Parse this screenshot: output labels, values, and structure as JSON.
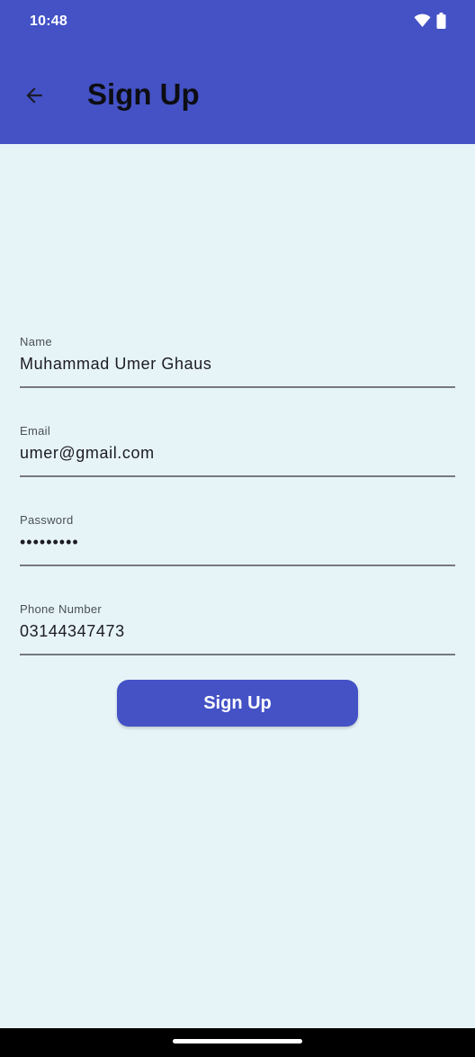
{
  "status_bar": {
    "time": "10:48",
    "icons": [
      "wifi-icon",
      "battery-icon"
    ]
  },
  "app_bar": {
    "title": "Sign Up",
    "back_icon": "arrow-back-icon"
  },
  "form": {
    "fields": [
      {
        "label": "Name",
        "value": "Muhammad Umer Ghaus"
      },
      {
        "label": "Email",
        "value": "umer@gmail.com"
      },
      {
        "label": "Password",
        "value": "•••••••••"
      },
      {
        "label": "Phone Number",
        "value": "03144347473"
      }
    ],
    "submit_label": "Sign Up"
  },
  "colors": {
    "primary": "#4452C6",
    "background": "#E6F4F8",
    "underline": "#77797D"
  }
}
